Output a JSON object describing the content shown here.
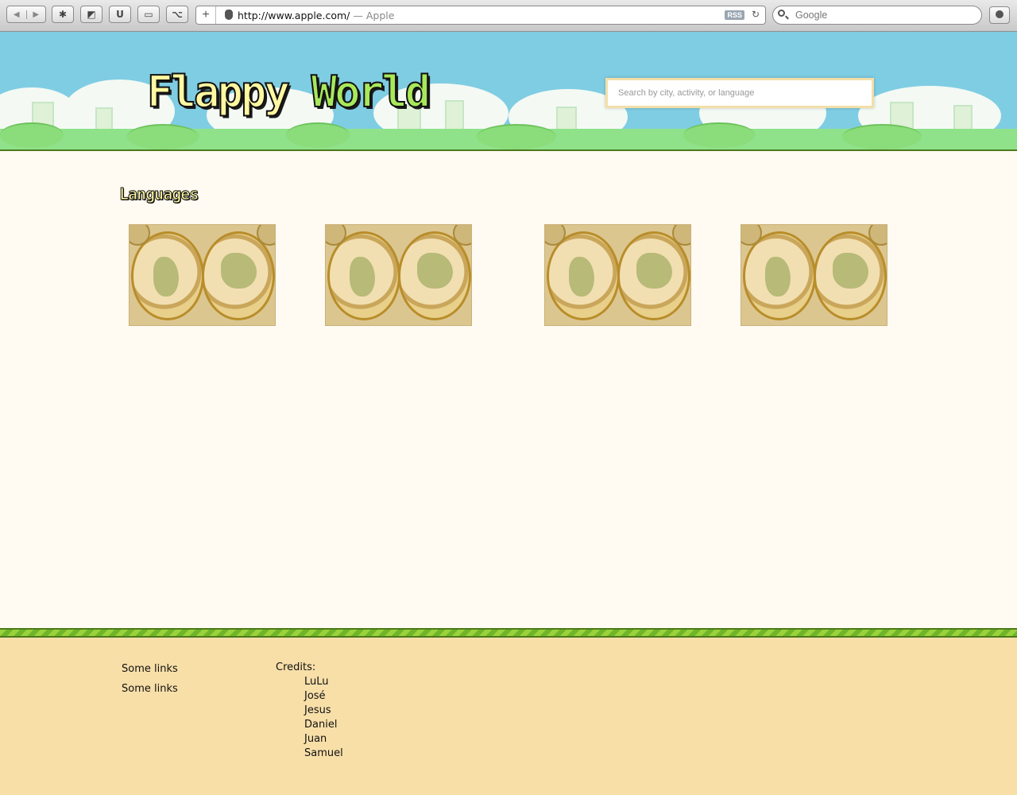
{
  "browser": {
    "url": "http://www.apple.com/",
    "page_title_suffix": "— Apple",
    "rss_label": "RSS",
    "search_placeholder": "Google",
    "new_tab_label": "+"
  },
  "header": {
    "logo_part1": "Flappy",
    "logo_part2": "World",
    "search_placeholder": "Search by city, activity, or language"
  },
  "main": {
    "section_title": "Languages",
    "thumbnails": [
      {
        "icon": "world-map-image"
      },
      {
        "icon": "world-map-image"
      },
      {
        "icon": "world-map-image"
      },
      {
        "icon": "world-map-image"
      }
    ]
  },
  "footer": {
    "links": [
      "Some links",
      "Some links"
    ],
    "credits_label": "Credits:",
    "credits": [
      "LuLu",
      "José",
      "Jesus",
      "Daniel",
      "Juan",
      "Samuel"
    ]
  },
  "colors": {
    "sky": "#7fcde3",
    "ground": "#8fe28a",
    "content_bg": "#fffaf2",
    "footer_bg": "#f8dfa8",
    "stripe_light": "#9bd23a",
    "stripe_dark": "#6fb52a"
  }
}
